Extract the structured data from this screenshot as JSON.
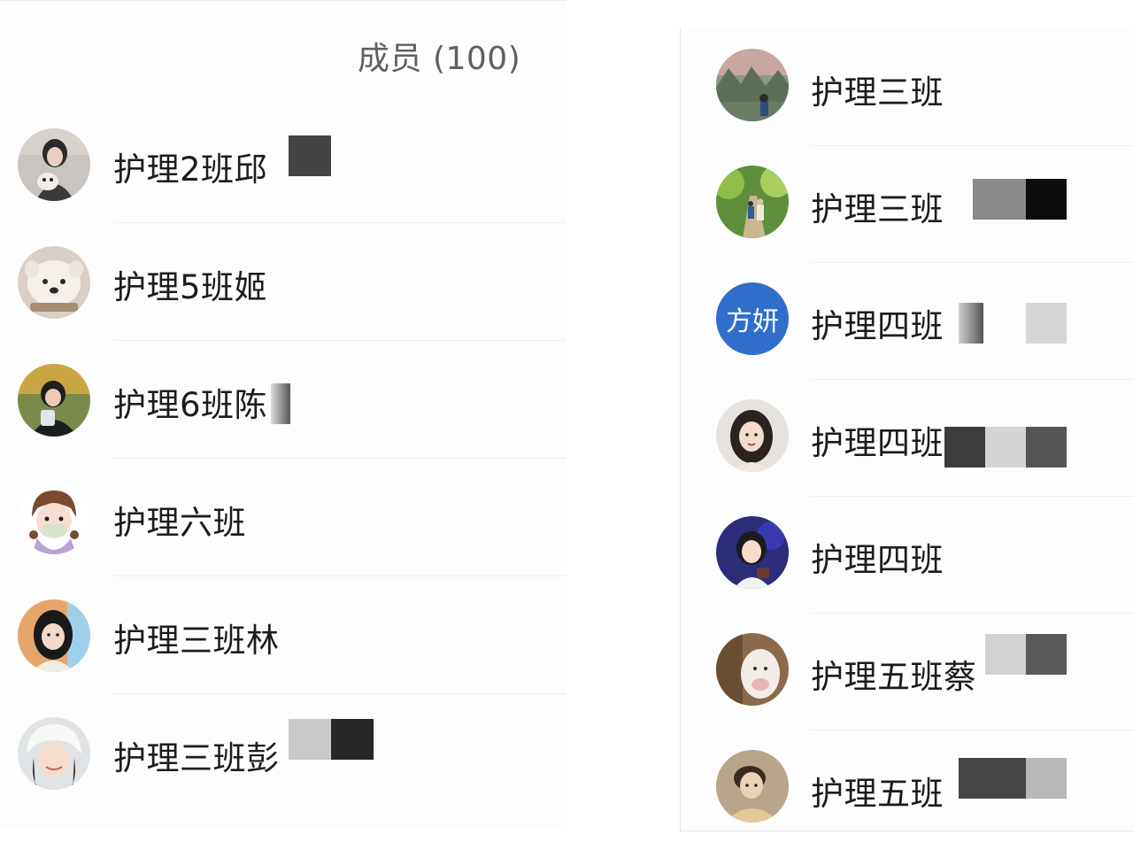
{
  "left": {
    "title": "成员 (100)",
    "members": [
      {
        "name": "护理2班邱",
        "avatar_icon": "avatar-woman-with-dog-icon"
      },
      {
        "name": "护理5班姬",
        "avatar_icon": "avatar-white-dog-icon"
      },
      {
        "name": "护理6班陈",
        "avatar_icon": "avatar-girl-eating-icon"
      },
      {
        "name": "护理六班",
        "avatar_icon": "avatar-cartoon-girl-icon"
      },
      {
        "name": "护理三班林",
        "avatar_icon": "avatar-young-woman-icon"
      },
      {
        "name": "护理三班彭",
        "avatar_icon": "avatar-girl-white-hat-icon"
      }
    ]
  },
  "right": {
    "members": [
      {
        "name": "护理三班",
        "avatar_icon": "avatar-landscape-icon"
      },
      {
        "name": "护理三班",
        "avatar_icon": "avatar-forest-path-icon"
      },
      {
        "name": "护理四班",
        "avatar_icon": "avatar-text-icon",
        "avatar_text": "方妍",
        "avatar_color": "#2f6fcb"
      },
      {
        "name": "护理四班",
        "avatar_icon": "avatar-woman-portrait-icon"
      },
      {
        "name": "护理四班",
        "avatar_icon": "avatar-girl-purple-bg-icon"
      },
      {
        "name": "护理五班蔡",
        "avatar_icon": "avatar-plush-toy-icon"
      },
      {
        "name": "护理五班",
        "avatar_icon": "avatar-man-hoodie-icon"
      }
    ]
  }
}
